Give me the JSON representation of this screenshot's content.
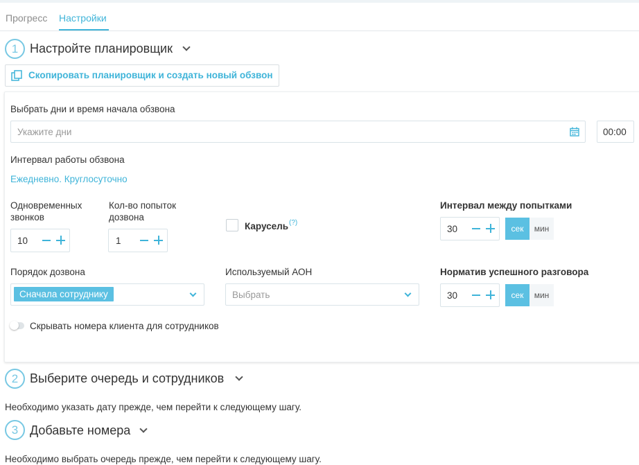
{
  "tabs": [
    {
      "label": "Прогресс",
      "active": false
    },
    {
      "label": "Настройки",
      "active": true
    }
  ],
  "step1": {
    "number": "1",
    "title": "Настройте планировщик"
  },
  "copy_button": {
    "label": "Скопировать планировщик и создать новый обзвон",
    "icon": "copy-icon"
  },
  "schedule": {
    "days_label": "Выбрать дни и время начала обзвона",
    "days_placeholder": "Укажите дни",
    "time_value": "00:00",
    "interval_label": "Интервал работы обзвона",
    "interval_value": "Ежедневно. Круглосуточно"
  },
  "simultaneous": {
    "label_line1": "Одновременных",
    "label_line2": "звонков",
    "value": "10"
  },
  "attempts": {
    "label_line1": "Кол-во попыток",
    "label_line2": "дозвона",
    "value": "1"
  },
  "carousel": {
    "label": "Карусель",
    "help": "(?)",
    "checked": false
  },
  "attempt_interval": {
    "label": "Интервал между попытками",
    "value": "30",
    "units": [
      "сек",
      "мин"
    ],
    "selected_unit": "сек"
  },
  "dial_order": {
    "label": "Порядок дозвона",
    "value": "Сначала сотруднику"
  },
  "caller_id": {
    "label": "Используемый АОН",
    "placeholder": "Выбрать"
  },
  "success_norm": {
    "label": "Норматив успешного разговора",
    "value": "30",
    "units": [
      "сек",
      "мин"
    ],
    "selected_unit": "сек"
  },
  "hide_numbers": {
    "label": "Скрывать номера клиента для сотрудников",
    "enabled": false
  },
  "step2": {
    "number": "2",
    "title": "Выберите очередь и сотрудников",
    "note": "Необходимо указать дату прежде, чем перейти к следующему шагу."
  },
  "step3": {
    "number": "3",
    "title": "Добавьте номера",
    "note": "Необходимо выбрать очередь прежде, чем перейти к следующему шагу."
  },
  "colors": {
    "accent": "#3fb4d9",
    "accent_fill": "#5bc0e2",
    "border": "#d9e3e8"
  }
}
